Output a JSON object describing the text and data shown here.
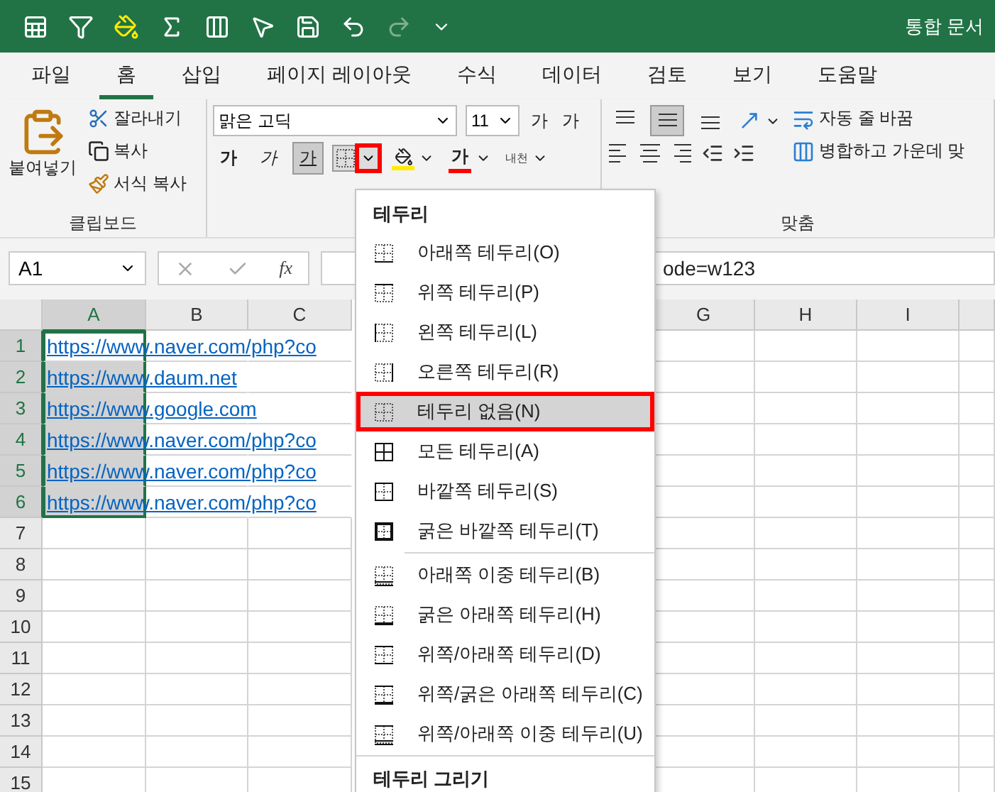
{
  "title": "통합 문서",
  "tabs": [
    {
      "label": "파일",
      "selected": false
    },
    {
      "label": "홈",
      "selected": true
    },
    {
      "label": "삽입",
      "selected": false
    },
    {
      "label": "페이지 레이아웃",
      "selected": false
    },
    {
      "label": "수식",
      "selected": false
    },
    {
      "label": "데이터",
      "selected": false
    },
    {
      "label": "검토",
      "selected": false
    },
    {
      "label": "보기",
      "selected": false
    },
    {
      "label": "도움말",
      "selected": false
    }
  ],
  "clipboard": {
    "paste": "붙여넣기",
    "cut": "잘라내기",
    "copy": "복사",
    "format_painter": "서식 복사",
    "label": "클립보드"
  },
  "font": {
    "name": "맑은 고딕",
    "size": "11",
    "grow": "가",
    "shrink": "가",
    "styles": [
      {
        "label": "가",
        "kind": "bold",
        "selected": false
      },
      {
        "label": "가",
        "kind": "italic",
        "selected": false
      },
      {
        "label": "가",
        "kind": "underline",
        "selected": true
      }
    ],
    "borders_highlighted": true,
    "font_color_label": "가",
    "phonetic": "내천"
  },
  "alignment": {
    "vertical": [
      {
        "kind": "top",
        "selected": false
      },
      {
        "kind": "middle",
        "selected": true
      },
      {
        "kind": "bottom",
        "selected": false
      }
    ],
    "wrap": "자동 줄 바꿈",
    "merge": "병합하고 가운데 맞",
    "label": "맞춤"
  },
  "name_box": "A1",
  "function_label": "fx",
  "formula": "ode=w123",
  "columns": [
    {
      "label": "A",
      "selected": true
    },
    {
      "label": "B",
      "selected": false
    },
    {
      "label": "C",
      "selected": false
    },
    {
      "label": "G",
      "selected": false
    },
    {
      "label": "H",
      "selected": false
    },
    {
      "label": "I",
      "selected": false
    }
  ],
  "rows": [
    {
      "number": "1",
      "selected": true,
      "link": "https://www.naver.com/php?co"
    },
    {
      "number": "2",
      "selected": true,
      "link": "https://www.daum.net"
    },
    {
      "number": "3",
      "selected": true,
      "link": "https://www.google.com"
    },
    {
      "number": "4",
      "selected": true,
      "link": "https://www.naver.com/php?co"
    },
    {
      "number": "5",
      "selected": true,
      "link": "https://www.naver.com/php?co"
    },
    {
      "number": "6",
      "selected": true,
      "link": "https://www.naver.com/php?co"
    },
    {
      "number": "7",
      "selected": false
    },
    {
      "number": "8",
      "selected": false
    },
    {
      "number": "9",
      "selected": false
    },
    {
      "number": "10",
      "selected": false
    },
    {
      "number": "11",
      "selected": false
    },
    {
      "number": "12",
      "selected": false
    },
    {
      "number": "13",
      "selected": false
    },
    {
      "number": "14",
      "selected": false
    },
    {
      "number": "15",
      "selected": false
    }
  ],
  "border_menu": {
    "title": "테두리",
    "sections": [
      [
        {
          "label": "아래쪽 테두리(O)",
          "kind": "bottom",
          "selected": false,
          "highlighted": false
        },
        {
          "label": "위쪽 테두리(P)",
          "kind": "top",
          "selected": false,
          "highlighted": false
        },
        {
          "label": "왼쪽 테두리(L)",
          "kind": "left",
          "selected": false,
          "highlighted": false
        },
        {
          "label": "오른쪽 테두리(R)",
          "kind": "right",
          "selected": false,
          "highlighted": false
        },
        {
          "label": "테두리 없음(N)",
          "kind": "none",
          "selected": true,
          "highlighted": true
        },
        {
          "label": "모든 테두리(A)",
          "kind": "all",
          "selected": false,
          "highlighted": false
        },
        {
          "label": "바깥쪽 테두리(S)",
          "kind": "outside",
          "selected": false,
          "highlighted": false
        },
        {
          "label": "굵은 바깥쪽 테두리(T)",
          "kind": "thick-outside",
          "selected": false,
          "highlighted": false
        }
      ],
      [
        {
          "label": "아래쪽 이중 테두리(B)",
          "kind": "double-bottom",
          "selected": false,
          "highlighted": false
        },
        {
          "label": "굵은 아래쪽 테두리(H)",
          "kind": "thick-bottom",
          "selected": false,
          "highlighted": false
        },
        {
          "label": "위쪽/아래쪽 테두리(D)",
          "kind": "top-bottom",
          "selected": false,
          "highlighted": false
        },
        {
          "label": "위쪽/굵은 아래쪽 테두리(C)",
          "kind": "top-thick-bottom",
          "selected": false,
          "highlighted": false
        },
        {
          "label": "위쪽/아래쪽 이중 테두리(U)",
          "kind": "top-double-bottom",
          "selected": false,
          "highlighted": false
        }
      ]
    ],
    "draw_title": "테두리 그리기"
  }
}
